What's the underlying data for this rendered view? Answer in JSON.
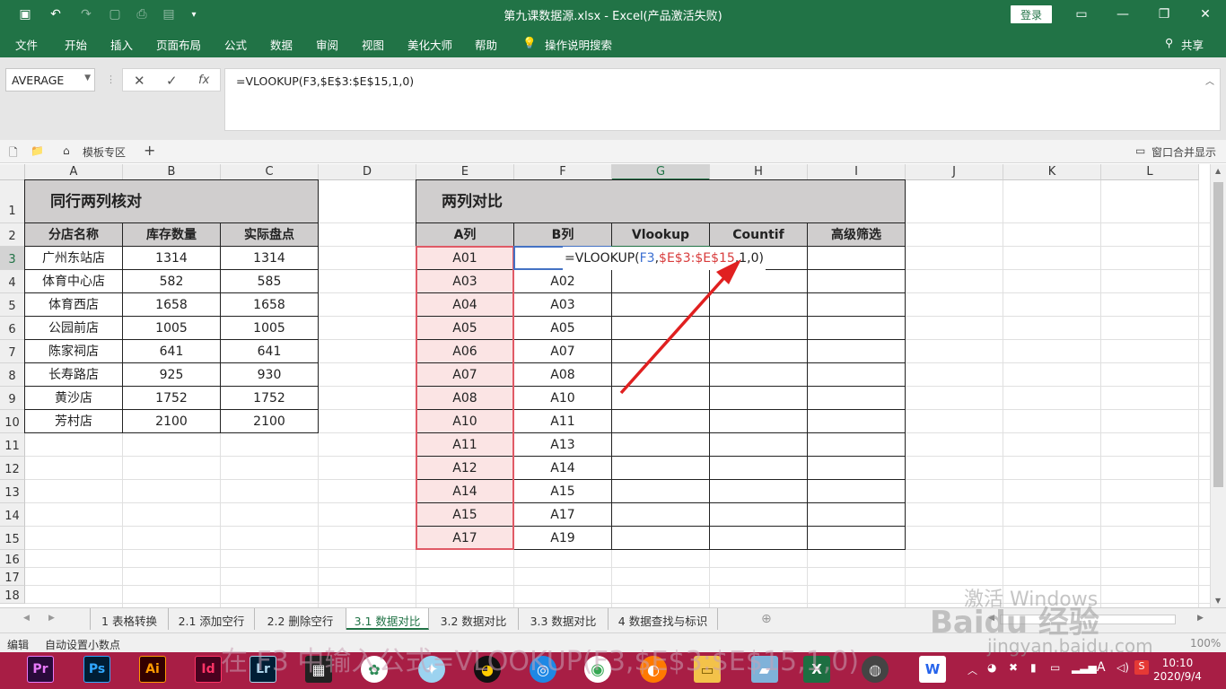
{
  "window": {
    "title": "第九课数据源.xlsx  -  Excel(产品激活失败)",
    "login_label": "登录"
  },
  "ribbon_tabs": [
    "文件",
    "开始",
    "插入",
    "页面布局",
    "公式",
    "数据",
    "审阅",
    "视图",
    "美化大师",
    "帮助",
    "操作说明搜索"
  ],
  "share_label": "共享",
  "formula_bar": {
    "name_box": "AVERAGE",
    "fx_label": "fx",
    "formula": "=VLOOKUP(F3,$E$3:$E$15,1,0)"
  },
  "template_bar": {
    "template_label": "模板专区",
    "plus": "+",
    "merge_label": "窗口合并显示"
  },
  "columns": [
    "A",
    "B",
    "C",
    "D",
    "E",
    "F",
    "G",
    "H",
    "I",
    "J",
    "K",
    "L"
  ],
  "rows": [
    "1",
    "2",
    "3",
    "4",
    "5",
    "6",
    "7",
    "8",
    "9",
    "10",
    "11",
    "12",
    "13",
    "14",
    "15",
    "16",
    "17",
    "18"
  ],
  "table1": {
    "title": "同行两列核对",
    "headers": [
      "分店名称",
      "库存数量",
      "实际盘点"
    ],
    "rows": [
      [
        "广州东站店",
        "1314",
        "1314"
      ],
      [
        "体育中心店",
        "582",
        "585"
      ],
      [
        "体育西店",
        "1658",
        "1658"
      ],
      [
        "公园前店",
        "1005",
        "1005"
      ],
      [
        "陈家祠店",
        "641",
        "641"
      ],
      [
        "长寿路店",
        "925",
        "930"
      ],
      [
        "黄沙店",
        "1752",
        "1752"
      ],
      [
        "芳村店",
        "2100",
        "2100"
      ]
    ]
  },
  "table2": {
    "title": "两列对比",
    "headers": [
      "A列",
      "B列",
      "Vlookup",
      "Countif",
      "高级筛选"
    ],
    "colA": [
      "A01",
      "A03",
      "A04",
      "A05",
      "A06",
      "A07",
      "A08",
      "A10",
      "A11",
      "A12",
      "A14",
      "A15",
      "A17"
    ],
    "colB": [
      "",
      "A02",
      "A03",
      "A05",
      "A07",
      "A08",
      "A10",
      "A11",
      "A13",
      "A14",
      "A15",
      "A17",
      "A19"
    ],
    "editing_formula": {
      "prefix": "=VLOOKUP(",
      "ref1": "F3",
      "comma1": ",",
      "ref2": "$E$3:$E$15",
      "rest": ",1,0)"
    }
  },
  "sheet_tabs": [
    "1 表格转换",
    "2.1 添加空行",
    "2.2 删除空行",
    "3.1 数据对比",
    "3.2 数据对比",
    "3.3 数据对比",
    "4 数据查找与标识"
  ],
  "active_sheet": "3.1 数据对比",
  "status": {
    "mode": "编辑",
    "info": "自动设置小数点",
    "zoom": "100%"
  },
  "taskbar": {
    "apps": [
      "Pr",
      "Ps",
      "Ai",
      "Id",
      "Lr"
    ],
    "time": "10:10",
    "date": "2020/9/4"
  },
  "watermark": {
    "caption": "在 F3 中输入公式=VLOOKUP(F3,$E$3:$E$15,1,0)",
    "brand": "Baidu 经验",
    "url": "jingyan.baidu.com",
    "activate": "激活 Windows"
  },
  "colors": {
    "excel_green": "#217346",
    "header_gray": "#d0cece",
    "range_pink": "#fbe4e4",
    "arrow_red": "#e02020",
    "taskbar": "#a81e45"
  }
}
